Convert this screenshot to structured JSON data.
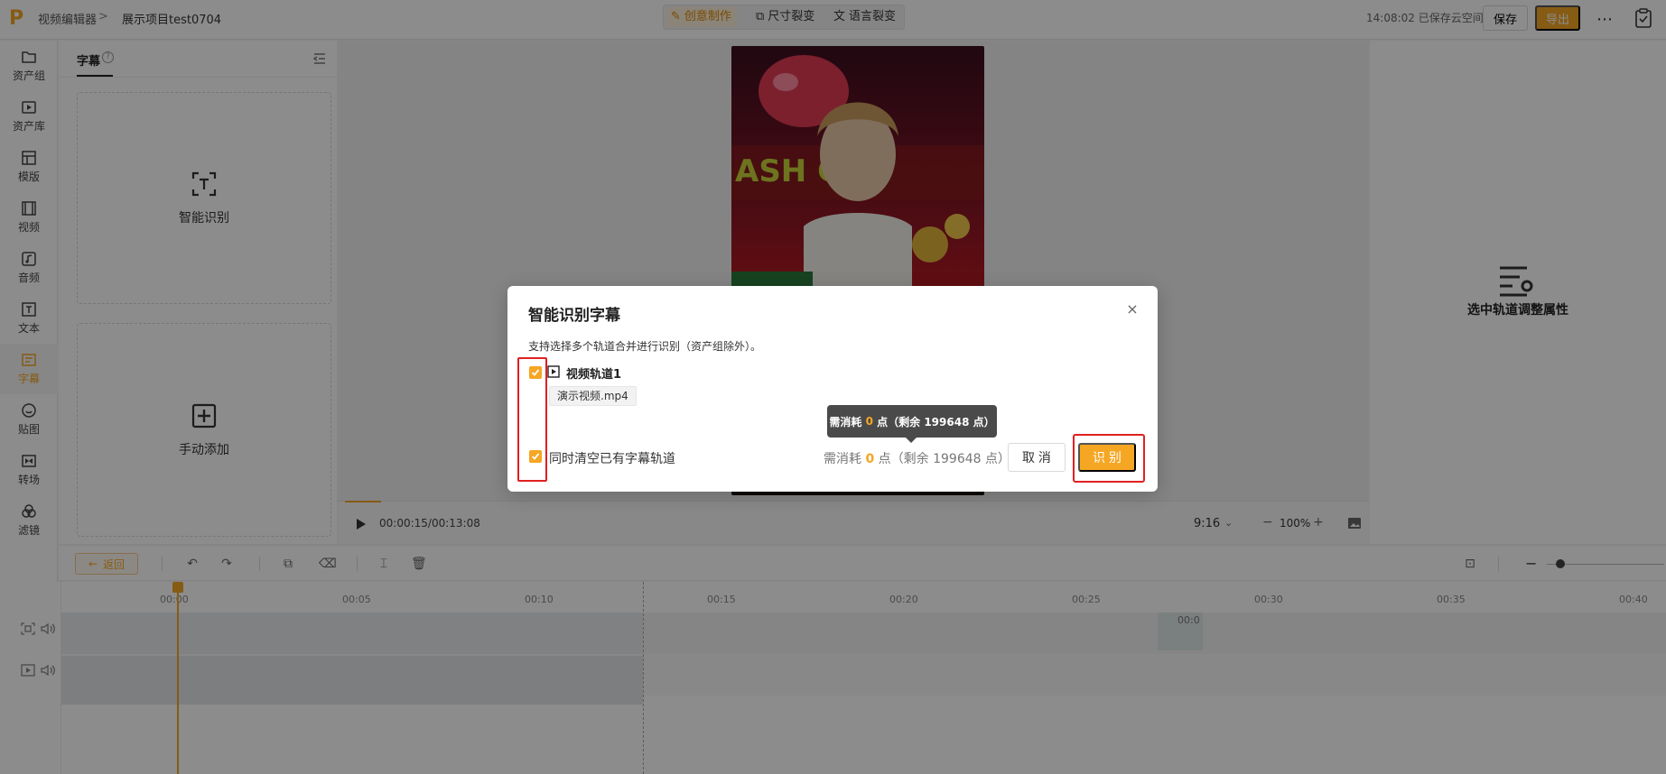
{
  "header": {
    "logo": "P",
    "breadcrumb_app": "视频编辑器",
    "breadcrumb_sep": ">",
    "project_name": "展示项目test0704",
    "modes": [
      "创意制作",
      "尺寸裂变",
      "语言裂变"
    ],
    "save_status": "14:08:02 已保存云空间",
    "save_label": "保存",
    "export_label": "导出",
    "more_icon": "⋯"
  },
  "sidebar": {
    "items": [
      {
        "label": "资产组",
        "icon": "folder-icon"
      },
      {
        "label": "资产库",
        "icon": "media-library-icon"
      },
      {
        "label": "模版",
        "icon": "template-icon"
      },
      {
        "label": "视频",
        "icon": "film-icon"
      },
      {
        "label": "音频",
        "icon": "music-icon"
      },
      {
        "label": "文本",
        "icon": "text-icon"
      },
      {
        "label": "字幕",
        "icon": "subtitle-icon",
        "active": true
      },
      {
        "label": "贴图",
        "icon": "sticker-icon"
      },
      {
        "label": "转场",
        "icon": "transition-icon"
      },
      {
        "label": "滤镜",
        "icon": "filter-icon"
      }
    ]
  },
  "panel": {
    "tab": "字幕",
    "help": "?",
    "auto_card": "智能识别",
    "manual_card": "手动添加"
  },
  "preview": {
    "timecode": "00:00:15/00:13:08",
    "ratio": "9:16",
    "zoom": "100%",
    "minus": "−",
    "plus": "+"
  },
  "right_panel": {
    "label": "选中轨道调整属性"
  },
  "toolbar": {
    "back_label": "返回",
    "zoom_minus": "−",
    "zoom_plus": "+"
  },
  "timeline": {
    "ticks": [
      "00:00",
      "00:05",
      "00:10",
      "00:15",
      "00:20",
      "00:25",
      "00:30",
      "00:35",
      "00:40"
    ],
    "mini_clip_label": "00:0"
  },
  "modal": {
    "title": "智能识别字幕",
    "close": "×",
    "description": "支持选择多个轨道合并进行识别（资产组除外）。",
    "track_name": "视频轨道1",
    "file_name": "演示视频.mp4",
    "clear_label": "同时清空已有字幕轨道",
    "cost_prefix": "需消耗",
    "cost_value": "0",
    "cost_suffix": "点（剩余 199648 点）",
    "cancel_label": "取 消",
    "recognize_label": "识 别",
    "checkbox_track_checked": true,
    "checkbox_clear_checked": true
  },
  "tooltip": {
    "prefix": "需消耗",
    "value": "0",
    "suffix": "点（剩余 199648 点）"
  },
  "colors": {
    "accent": "#f5a623",
    "highlight": "#e02020"
  }
}
